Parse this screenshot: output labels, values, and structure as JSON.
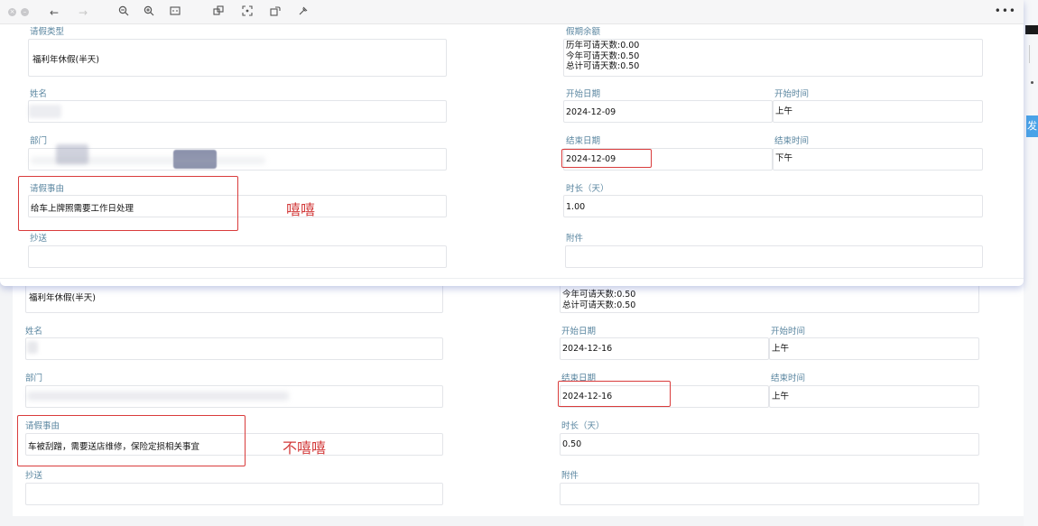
{
  "top_form": {
    "leave_type_label": "请假类型",
    "leave_type_value": "福利年休假(半天)",
    "balance_label": "假期余额",
    "balance_lines": [
      "历年可请天数:0.00",
      "今年可请天数:0.50",
      "总计可请天数:0.50"
    ],
    "name_label": "姓名",
    "start_date_label": "开始日期",
    "start_date_value": "2024-12-09",
    "start_time_label": "开始时间",
    "start_time_value": "上午",
    "dept_label": "部门",
    "end_date_label": "结束日期",
    "end_date_value": "2024-12-09",
    "end_time_label": "结束时间",
    "end_time_value": "下午",
    "reason_label": "请假事由",
    "reason_value": "给车上牌照需要工作日处理",
    "duration_label": "时长（天）",
    "duration_value": "1.00",
    "cc_label": "抄送",
    "attach_label": "附件",
    "annotation": "嘻嘻"
  },
  "bottom_form": {
    "leave_type_value": "福利年休假(半天)",
    "balance_lines": [
      "今年可请天数:0.50",
      "总计可请天数:0.50"
    ],
    "name_label": "姓名",
    "start_date_label": "开始日期",
    "start_date_value": "2024-12-16",
    "start_time_label": "开始时间",
    "start_time_value": "上午",
    "dept_label": "部门",
    "end_date_label": "结束日期",
    "end_date_value": "2024-12-16",
    "end_time_label": "结束时间",
    "end_time_value": "上午",
    "reason_label": "请假事由",
    "reason_value": "车被刮蹭，需要送店维修，保险定损相关事宜",
    "duration_label": "时长（天）",
    "duration_value": "0.50",
    "cc_label": "抄送",
    "attach_label": "附件",
    "annotation": "不嘻嘻"
  },
  "side_button": "发",
  "toolbar": {
    "icons": [
      "close-icon",
      "minimize-icon",
      "back-icon",
      "forward-icon",
      "zoom-out-icon",
      "zoom-in-icon",
      "fit-icon",
      "copy-icon",
      "crop-icon",
      "rotate-icon",
      "tools-icon"
    ],
    "more": "•••"
  }
}
